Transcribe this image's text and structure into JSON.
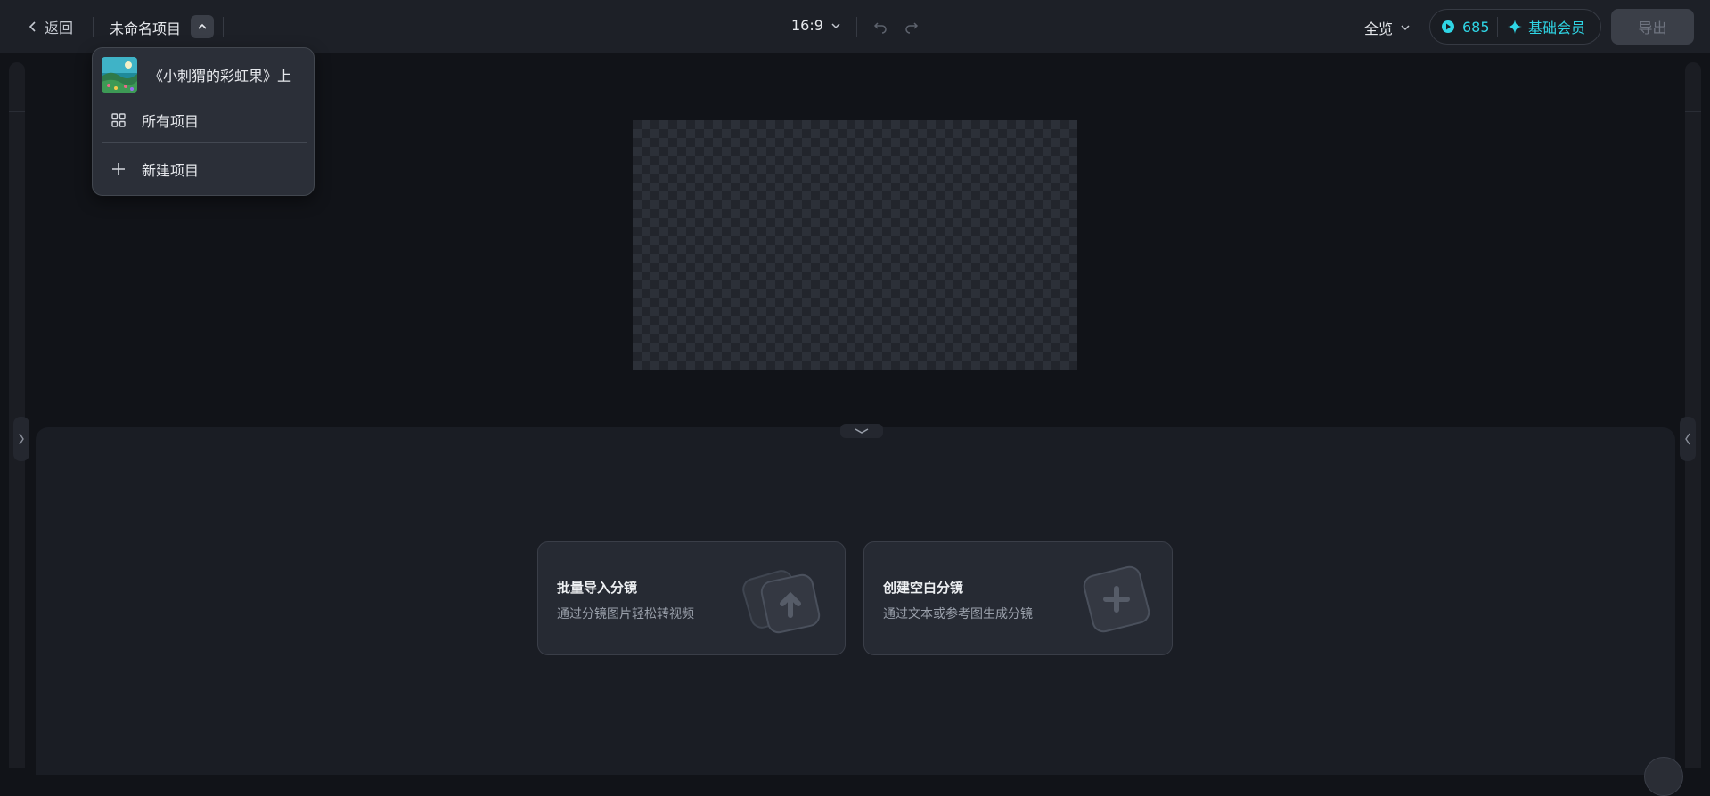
{
  "topbar": {
    "back_label": "返回",
    "project_name": "未命名项目",
    "aspect_ratio": "16:9",
    "view_mode": "全览",
    "credits": "685",
    "membership": "基础会员",
    "export_label": "导出"
  },
  "project_menu": {
    "recent_project": "《小刺猬的彩虹果》上",
    "all_projects": "所有项目",
    "new_project": "新建项目"
  },
  "storyboard": {
    "batch_import_title": "批量导入分镜",
    "batch_import_desc": "通过分镜图片轻松转视频",
    "create_blank_title": "创建空白分镜",
    "create_blank_desc": "通过文本或参考图生成分镜"
  },
  "colors": {
    "accent": "#2fd6e6",
    "background": "#111318",
    "panel": "#1a1d24",
    "card": "#262a33"
  }
}
